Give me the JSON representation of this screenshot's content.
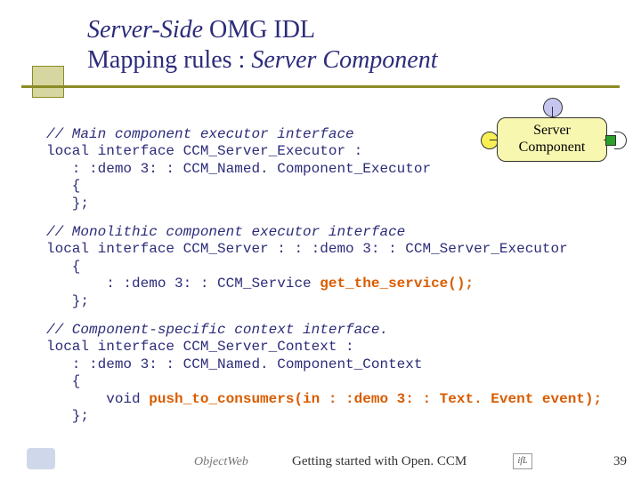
{
  "title": {
    "part1_italic": "Server-Side",
    "part1_rest": " OMG IDL",
    "part2_plain": "Mapping rules : ",
    "part2_italic": "Server Component"
  },
  "diagram": {
    "label_line1": "Server",
    "label_line2": "Component"
  },
  "code": {
    "b1": {
      "comment": "// Main component executor interface",
      "l1": "local interface CCM_Server_Executor :",
      "l2": "   : :demo 3: : CCM_Named. Component_Executor",
      "l3": "   {",
      "l4": "   };"
    },
    "b2": {
      "comment": "// Monolithic component executor interface",
      "l1": "local interface CCM_Server : : :demo 3: : CCM_Server_Executor",
      "l2": "   {",
      "l3a": "       : :demo 3: : CCM_Service ",
      "l3b": "get_the_service();",
      "l4": "   };"
    },
    "b3": {
      "comment": "// Component-specific context interface.",
      "l1": "local interface CCM_Server_Context :",
      "l2": "   : :demo 3: : CCM_Named. Component_Context",
      "l3": "   {",
      "l4a": "       void ",
      "l4b": "push_to_consumers(in : :demo 3: : Text. Event event);",
      "l5": "   };"
    }
  },
  "footer": {
    "objectweb": "ObjectWeb",
    "caption": "Getting started with Open. CCM",
    "ifl": "ifL",
    "page": "39"
  }
}
